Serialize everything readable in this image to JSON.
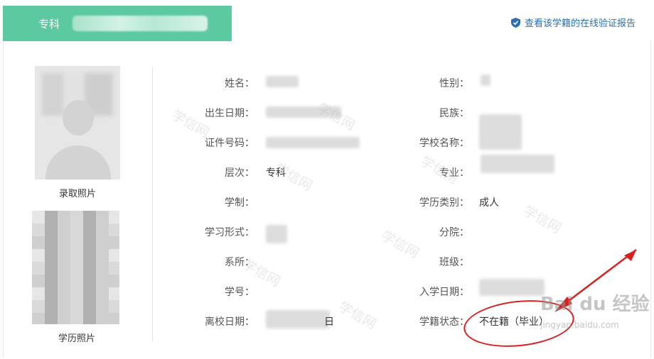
{
  "header": {
    "level_tab": "专科",
    "verify_link": "查看该学籍的在线验证报告"
  },
  "photos": {
    "admission_caption": "录取照片",
    "degree_caption": "学历照片"
  },
  "fields_left": [
    {
      "label": "姓名：",
      "value": ""
    },
    {
      "label": "出生日期：",
      "value": ""
    },
    {
      "label": "证件号码：",
      "value": ""
    },
    {
      "label": "层次：",
      "value": "专科"
    },
    {
      "label": "学制：",
      "value": ""
    },
    {
      "label": "学习形式：",
      "value": ""
    },
    {
      "label": "系所：",
      "value": ""
    },
    {
      "label": "学号：",
      "value": ""
    },
    {
      "label": "离校日期：",
      "value": "日"
    }
  ],
  "fields_right": [
    {
      "label": "性别：",
      "value": ""
    },
    {
      "label": "民族：",
      "value": ""
    },
    {
      "label": "学校名称：",
      "value": ""
    },
    {
      "label": "专业：",
      "value": ""
    },
    {
      "label": "学历类别：",
      "value": "成人"
    },
    {
      "label": "分院：",
      "value": ""
    },
    {
      "label": "班级：",
      "value": ""
    },
    {
      "label": "入学日期：",
      "value": ""
    },
    {
      "label": "学籍状态：",
      "value": "不在籍（毕业）"
    }
  ],
  "watermark": {
    "site_text": "学信网",
    "baidu_brand": "Bai du 经验",
    "baidu_site": "jingyan.baidu.com"
  },
  "colors": {
    "tab_green": "#5cc9a0",
    "link_blue": "#2a6fb4",
    "annotation_red": "#d82020"
  }
}
